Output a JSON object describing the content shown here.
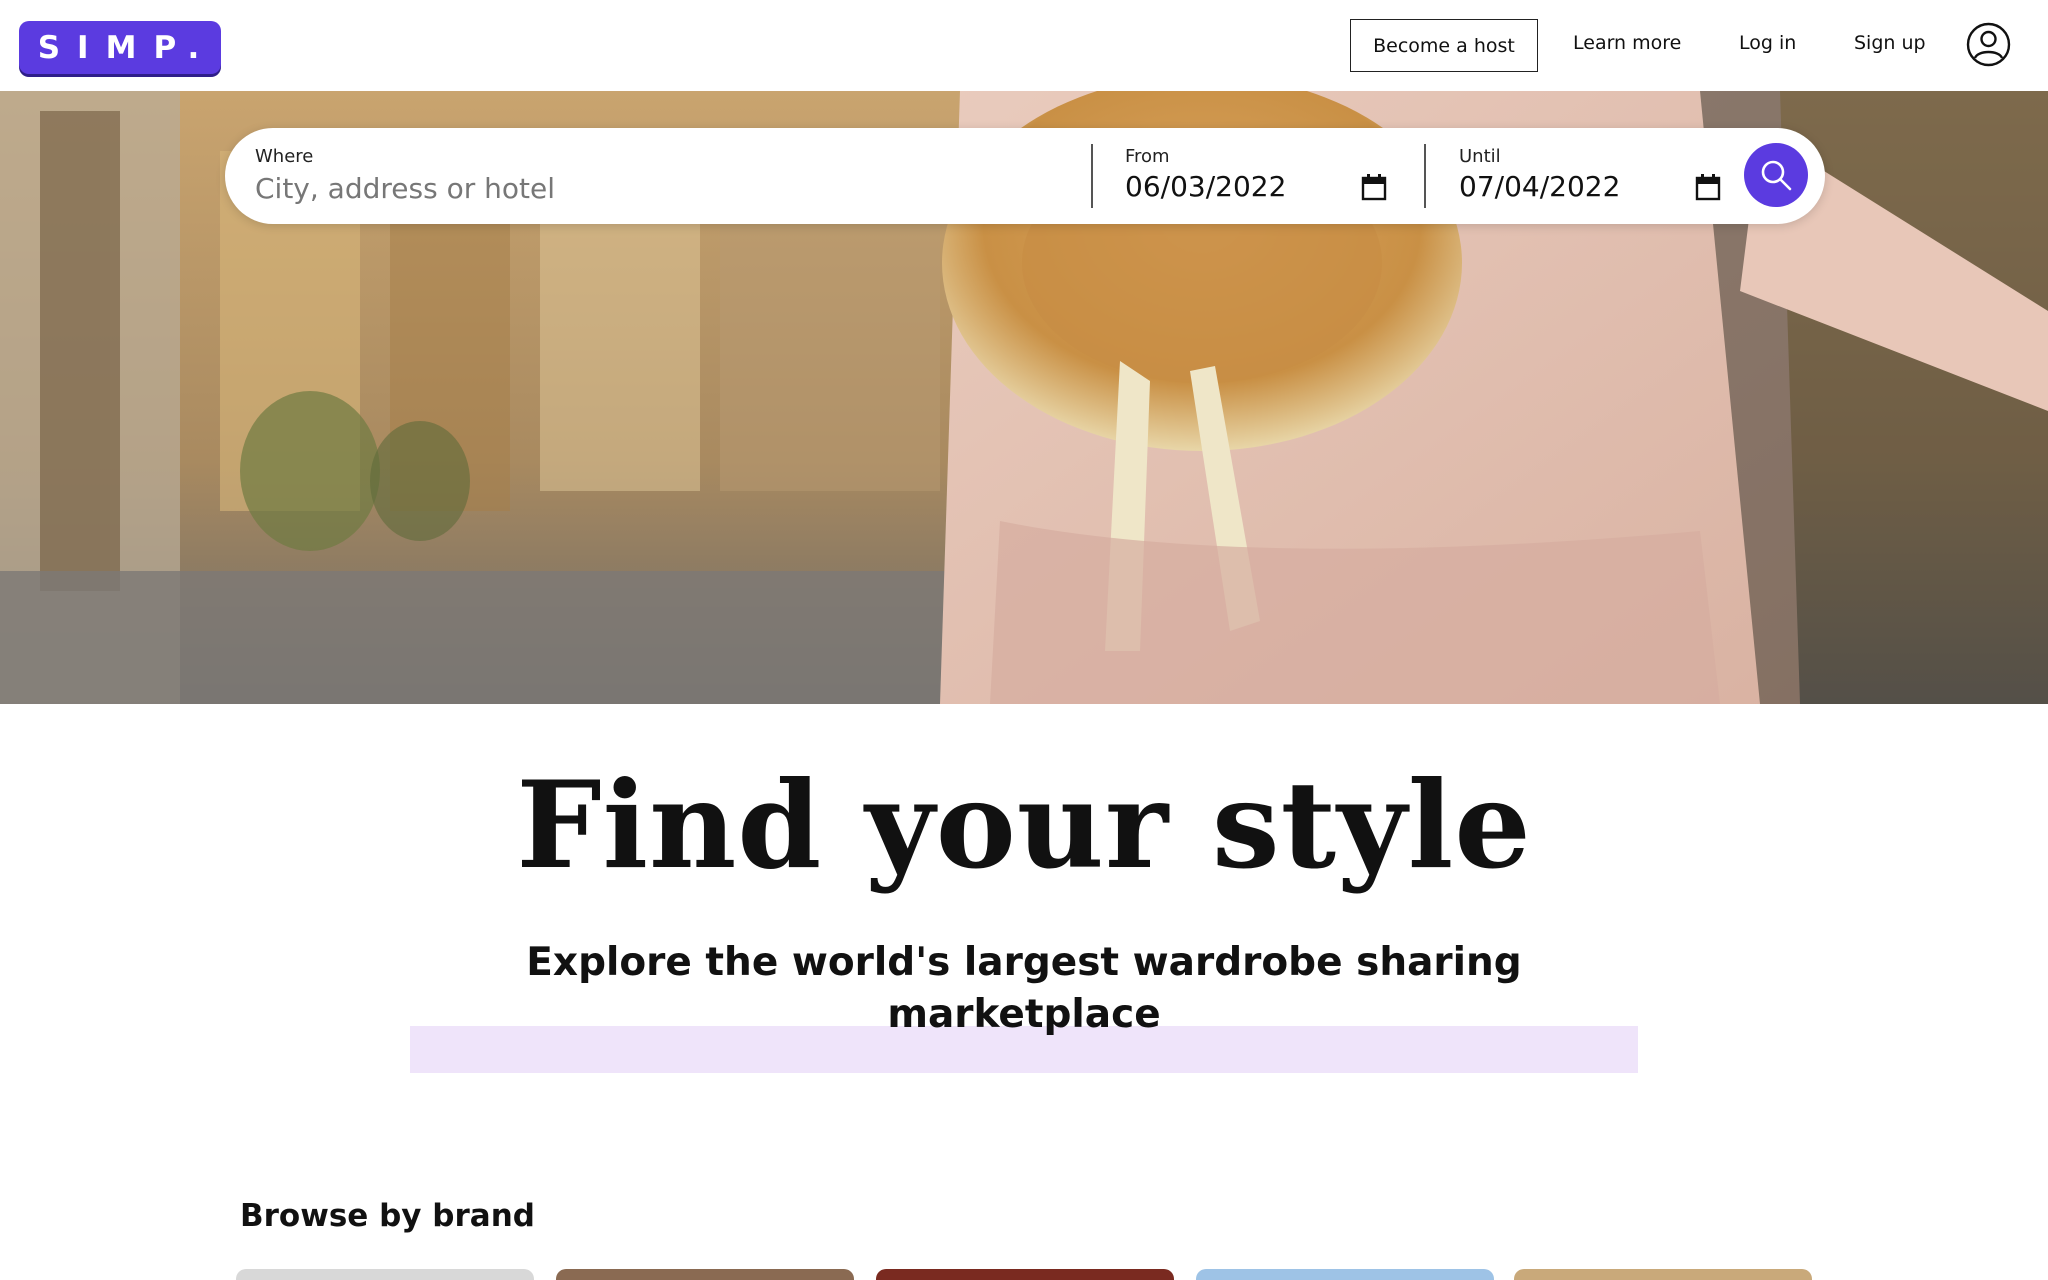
{
  "header": {
    "logo": "SIMP.",
    "nav": {
      "become_host": "Become a host",
      "learn_more": "Learn more",
      "log_in": "Log in",
      "sign_up": "Sign up"
    },
    "profile_icon": "user-circle-icon"
  },
  "search": {
    "where_label": "Where",
    "where_placeholder": "City, address or hotel",
    "from_label": "From",
    "from_value": "06/03/2022",
    "until_label": "Until",
    "until_value": "07/04/2022",
    "calendar_icon": "calendar-icon",
    "search_icon": "search-icon"
  },
  "main": {
    "title": "Find your style",
    "subtitle": "Explore the world's largest wardrobe sharing marketplace",
    "browse_title": "Browse by brand"
  },
  "colors": {
    "accent": "#5b3be0",
    "highlight": "#efe4fa"
  }
}
